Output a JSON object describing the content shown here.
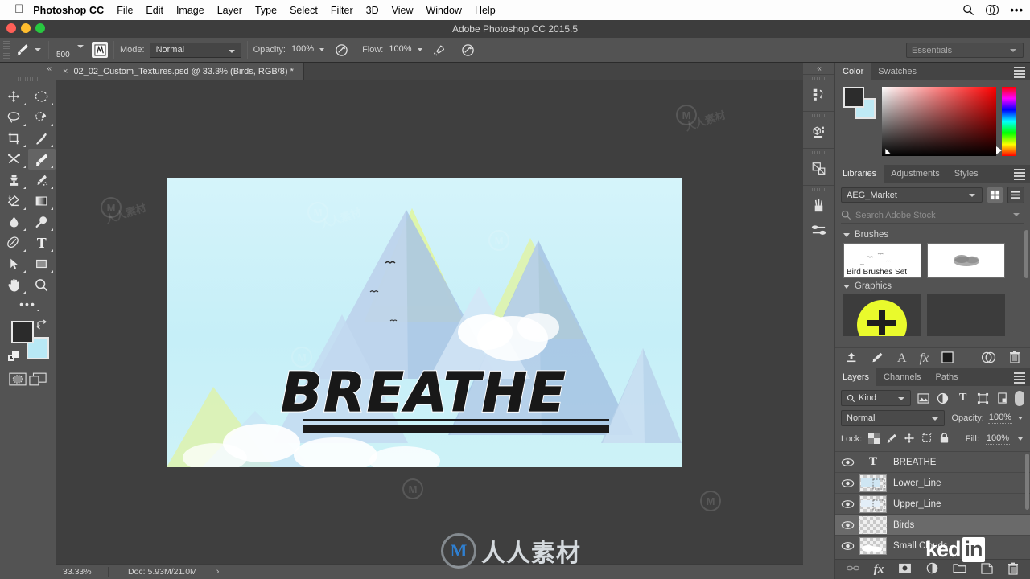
{
  "macmenu": {
    "app_name": "Photoshop CC",
    "items": [
      "File",
      "Edit",
      "Image",
      "Layer",
      "Type",
      "Select",
      "Filter",
      "3D",
      "View",
      "Window",
      "Help"
    ],
    "right_icons": [
      "search-icon",
      "creative-cloud-icon",
      "more-icon"
    ]
  },
  "titlebar": {
    "title": "Adobe Photoshop CC 2015.5"
  },
  "options": {
    "brush_size": "500",
    "mode_label": "Mode:",
    "mode_value": "Normal",
    "opacity_label": "Opacity:",
    "opacity_value": "100%",
    "flow_label": "Flow:",
    "flow_value": "100%",
    "workspace": "Essentials"
  },
  "tab": {
    "close": "×",
    "title": "02_02_Custom_Textures.psd @ 33.3% (Birds, RGB/8) *"
  },
  "toolbar": {
    "collapse": "«",
    "tools": [
      {
        "name": "move-tool",
        "glyph": "move"
      },
      {
        "name": "elliptical-marquee-tool",
        "glyph": "ellipse-marquee"
      },
      {
        "name": "lasso-tool",
        "glyph": "lasso"
      },
      {
        "name": "quick-selection-tool",
        "glyph": "quick-select"
      },
      {
        "name": "crop-tool",
        "glyph": "crop"
      },
      {
        "name": "eyedropper-tool",
        "glyph": "eyedropper"
      },
      {
        "name": "healing-brush-tool",
        "glyph": "healing"
      },
      {
        "name": "brush-tool",
        "glyph": "brush"
      },
      {
        "name": "clone-stamp-tool",
        "glyph": "stamp"
      },
      {
        "name": "history-brush-tool",
        "glyph": "history-brush"
      },
      {
        "name": "eraser-tool",
        "glyph": "eraser"
      },
      {
        "name": "gradient-tool",
        "glyph": "gradient"
      },
      {
        "name": "blur-tool",
        "glyph": "blur"
      },
      {
        "name": "dodge-tool",
        "glyph": "dodge"
      },
      {
        "name": "pen-tool",
        "glyph": "pen"
      },
      {
        "name": "type-tool",
        "glyph": "type"
      },
      {
        "name": "path-selection-tool",
        "glyph": "path-select"
      },
      {
        "name": "rectangle-tool",
        "glyph": "rectangle"
      },
      {
        "name": "hand-tool",
        "glyph": "hand"
      },
      {
        "name": "zoom-tool",
        "glyph": "zoom"
      }
    ],
    "active_tool": "brush-tool",
    "foreground_color": "#2b2b2b",
    "background_color": "#b8e8f5"
  },
  "canvas": {
    "artwork_title": "BREATHE",
    "sky_color": "#cdf2f7",
    "mountain_blue": "#9ab6dd",
    "mountain_green": "#d9f29a",
    "birds_count": 3
  },
  "statusbar": {
    "zoom": "33.33%",
    "doc": "Doc: 5.93M/21.0M",
    "arrow": "›"
  },
  "rail": {
    "collapse": "«",
    "icons": [
      "history-panel-icon",
      "3d-panel-icon",
      "properties-panel-icon",
      "brushes-panel-icon",
      "brush-settings-panel-icon"
    ]
  },
  "color_panel": {
    "tabs": [
      {
        "label": "Color",
        "active": true
      },
      {
        "label": "Swatches",
        "active": false
      }
    ],
    "foreground": "#2c2c2c",
    "background": "#bfeaf5"
  },
  "libraries_panel": {
    "tabs": [
      {
        "label": "Libraries",
        "active": true
      },
      {
        "label": "Adjustments",
        "active": false
      },
      {
        "label": "Styles",
        "active": false
      }
    ],
    "library_name": "AEG_Market",
    "search_placeholder": "Search Adobe Stock",
    "sections": [
      {
        "title": "Brushes",
        "items": [
          {
            "caption": "Bird Brushes Set",
            "kind": "brush-stroke"
          },
          {
            "caption": "",
            "kind": "cloud-brush"
          }
        ]
      },
      {
        "title": "Graphics",
        "items": [
          {
            "caption": "",
            "kind": "yellow-circle-graphic"
          },
          {
            "caption": "",
            "kind": "transparent-graphic"
          }
        ]
      }
    ],
    "footer_icons": [
      "upload-icon",
      "add-graphic-icon",
      "add-text-icon",
      "add-layer-style-icon",
      "add-color-icon",
      "creative-cloud-icon",
      "delete-icon"
    ]
  },
  "layers_panel": {
    "tabs": [
      {
        "label": "Layers",
        "active": true
      },
      {
        "label": "Channels",
        "active": false
      },
      {
        "label": "Paths",
        "active": false
      }
    ],
    "kind_filter": "Kind",
    "filter_icons": [
      "pixel-filter-icon",
      "adjustment-filter-icon",
      "type-filter-icon",
      "shape-filter-icon",
      "smart-object-filter-icon"
    ],
    "blend_mode": "Normal",
    "opacity_label": "Opacity:",
    "opacity_value": "100%",
    "lock_label": "Lock:",
    "lock_icons": [
      "lock-transparent-pixels-icon",
      "lock-image-pixels-icon",
      "lock-position-icon",
      "lock-artboard-icon",
      "lock-all-icon"
    ],
    "fill_label": "Fill:",
    "fill_value": "100%",
    "layers": [
      {
        "name": "BREATHE",
        "type": "text",
        "visible": true,
        "selected": false
      },
      {
        "name": "Lower_Line",
        "type": "shape",
        "visible": true,
        "selected": false
      },
      {
        "name": "Upper_Line",
        "type": "shape",
        "visible": true,
        "selected": false
      },
      {
        "name": "Birds",
        "type": "pixel",
        "visible": true,
        "selected": true
      },
      {
        "name": "Small Clouds",
        "type": "pixel",
        "visible": true,
        "selected": false
      }
    ],
    "footer_icons": [
      "link-layers-icon",
      "add-layer-style-icon",
      "add-layer-mask-icon",
      "new-adjustment-layer-icon",
      "new-group-icon",
      "new-layer-icon",
      "delete-layer-icon"
    ]
  },
  "watermarks": {
    "chinese_text": "人人素材",
    "logo_letter": "M",
    "linkedin_left": "ked",
    "linkedin_right": "in"
  }
}
